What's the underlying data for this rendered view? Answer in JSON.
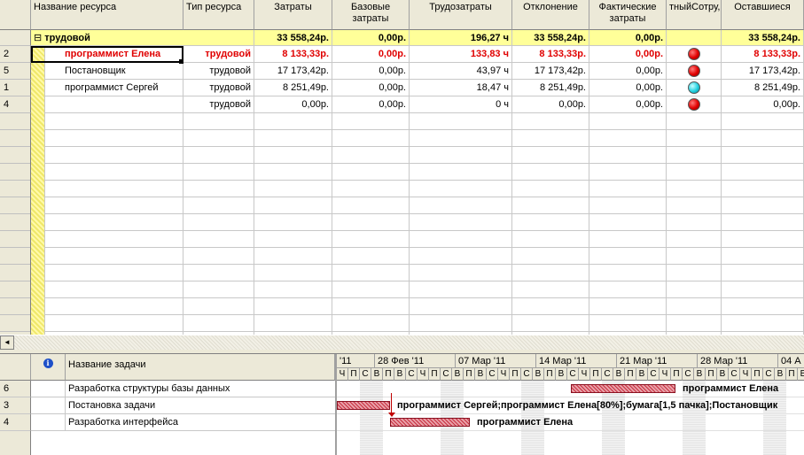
{
  "colors": {
    "group_fill": "#ffff99",
    "critical_text": "#e00000",
    "header_fill": "#ece9d8",
    "gantt_bar": "#c83040"
  },
  "resource_sheet": {
    "columns": [
      {
        "label": "Название ресурса"
      },
      {
        "label": "Тип ресурса"
      },
      {
        "label": "Затраты"
      },
      {
        "label": "Базовые затраты"
      },
      {
        "label": "Трудозатраты"
      },
      {
        "label": "Отклонение"
      },
      {
        "label": "Фактические затраты"
      },
      {
        "label": "тныйСотру,"
      },
      {
        "label": "Оставшиеся"
      }
    ],
    "group": {
      "toggle": "⊟",
      "name": "трудовой",
      "cost": "33 558,24р.",
      "baseline_cost": "0,00р.",
      "work": "196,27 ч",
      "variance": "33 558,24р.",
      "actual_cost": "0,00р.",
      "remaining": "33 558,24р."
    },
    "rows": [
      {
        "id": "2",
        "name": "программист Елена",
        "type": "трудовой",
        "cost": "8 133,33р.",
        "baseline": "0,00р.",
        "work": "133,83 ч",
        "variance": "8 133,33р.",
        "actual": "0,00р.",
        "indicator": "red-dot",
        "remaining": "8 133,33р.",
        "critical": true
      },
      {
        "id": "5",
        "name": "Постановщик",
        "type": "трудовой",
        "cost": "17 173,42р.",
        "baseline": "0,00р.",
        "work": "43,97 ч",
        "variance": "17 173,42р.",
        "actual": "0,00р.",
        "indicator": "red-dot",
        "remaining": "17 173,42р.",
        "critical": false
      },
      {
        "id": "1",
        "name": "программист Сергей",
        "type": "трудовой",
        "cost": "8 251,49р.",
        "baseline": "0,00р.",
        "work": "18,47 ч",
        "variance": "8 251,49р.",
        "actual": "0,00р.",
        "indicator": "cyan-dot",
        "remaining": "8 251,49р.",
        "critical": false
      },
      {
        "id": "4",
        "name": "",
        "type": "трудовой",
        "cost": "0,00р.",
        "baseline": "0,00р.",
        "work": "0 ч",
        "variance": "0,00р.",
        "actual": "0,00р.",
        "indicator": "red-dot",
        "remaining": "0,00р.",
        "critical": false
      }
    ]
  },
  "task_pane": {
    "indicator_header_icon": "info-icon",
    "name_header": "Название задачи",
    "tasks": [
      {
        "id": "6",
        "name": "Разработка структуры базы данных",
        "bar_label": "программист Елена"
      },
      {
        "id": "3",
        "name": "Постановка задачи",
        "bar_label": "программист Сергей;программист Елена[80%];бумага[1,5 пачка];Постановщик"
      },
      {
        "id": "4",
        "name": "Разработка интерфейса",
        "bar_label": "программист Елена"
      }
    ],
    "timescale": {
      "weeks": [
        "'11",
        "28 Фев '11",
        "07 Мар '11",
        "14 Мар '11",
        "21 Мар '11",
        "28 Мар '11",
        "04 А"
      ],
      "day_letters": [
        "Ч",
        "П",
        "С",
        "В",
        "П",
        "В",
        "С",
        "Ч",
        "П",
        "С",
        "В",
        "П",
        "В",
        "С",
        "Ч",
        "П",
        "С",
        "В",
        "П",
        "В",
        "С",
        "Ч",
        "П",
        "С",
        "В",
        "П",
        "В",
        "С",
        "Ч",
        "П",
        "С",
        "В",
        "П",
        "В",
        "С",
        "Ч",
        "П",
        "С",
        "В",
        "П",
        "В"
      ]
    }
  },
  "scroll_left_arrow": "◄"
}
